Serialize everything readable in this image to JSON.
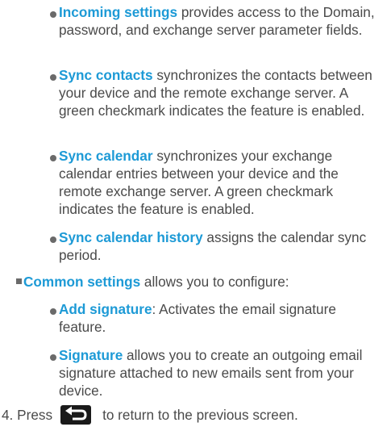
{
  "sub_items_1": [
    {
      "term": "Incoming settings",
      "text": " provides access to the Domain, password, and exchange server parameter fields."
    },
    {
      "term": "Sync contacts",
      "text": " synchronizes the contacts between your device and the remote exchange server. A green checkmark indicates the feature is enabled."
    },
    {
      "term": "Sync calendar",
      "text": " synchronizes your exchange calendar entries between your device and the remote exchange server. A green checkmark indicates the feature is enabled."
    },
    {
      "term": "Sync calendar history",
      "text": " assigns the calendar sync period."
    }
  ],
  "main_item": {
    "term": "Common settings",
    "text": " allows you to configure:"
  },
  "sub_items_2": [
    {
      "term": "Add signature",
      "text": ": Activates the email signature feature."
    },
    {
      "term": "Signature",
      "text": " allows you to create an outgoing email signature attached to new emails sent from your device."
    }
  ],
  "step": {
    "number": "4.",
    "before": "Press",
    "icon": "back-arrow-icon",
    "after": "to return to the previous screen."
  },
  "colors": {
    "accent": "#1d9ad6",
    "text": "#4a4a4a"
  }
}
